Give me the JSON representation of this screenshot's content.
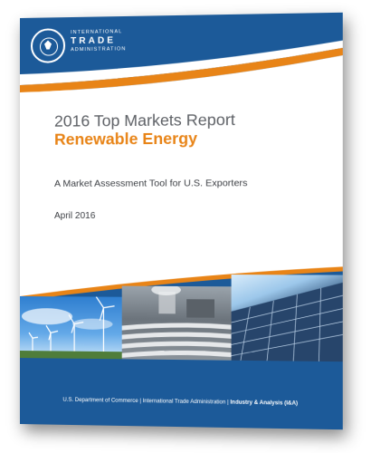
{
  "header": {
    "org_line1": "INTERNATIONAL",
    "org_line2": "TRADE",
    "org_line3": "ADMINISTRATION"
  },
  "cover": {
    "title": "2016 Top Markets Report",
    "subtitle": "Renewable Energy",
    "tagline": "A Market Assessment Tool for U.S. Exporters",
    "date": "April 2016"
  },
  "footer": {
    "part1": "U.S. Department of Commerce",
    "sep1": " | ",
    "part2": "International Trade Administration",
    "sep2": " | ",
    "part3": "Industry & Analysis (I&A)"
  },
  "colors": {
    "navy": "#1c5a99",
    "orange": "#e88417",
    "title_gray": "#5e6166"
  }
}
